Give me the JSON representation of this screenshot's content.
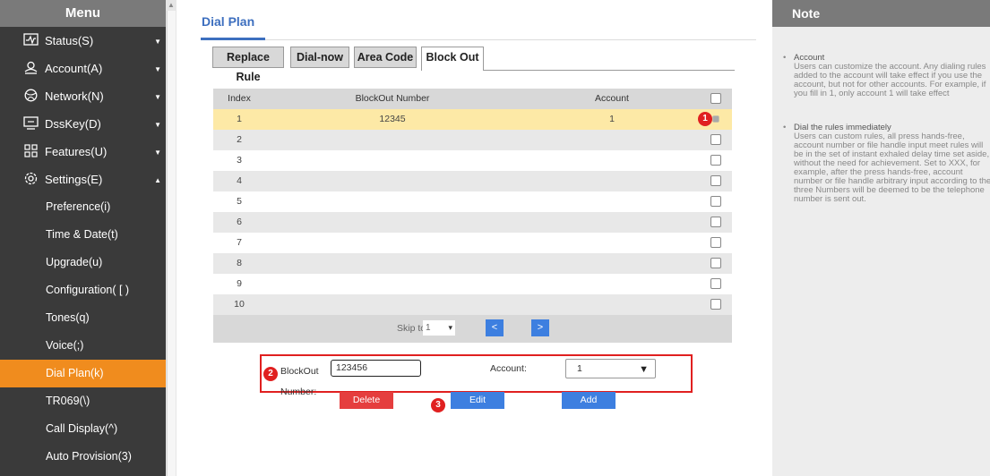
{
  "sidebar": {
    "header": "Menu",
    "items": [
      {
        "label": "Status(S)",
        "icon": "status-icon",
        "caret": "▼"
      },
      {
        "label": "Account(A)",
        "icon": "account-icon",
        "caret": "▼"
      },
      {
        "label": "Network(N)",
        "icon": "network-icon",
        "caret": "▼"
      },
      {
        "label": "DssKey(D)",
        "icon": "dsskey-icon",
        "caret": "▼"
      },
      {
        "label": "Features(U)",
        "icon": "features-icon",
        "caret": "▼"
      },
      {
        "label": "Settings(E)",
        "icon": "settings-icon",
        "caret": "▲"
      }
    ],
    "subitems": [
      "Preference(i)",
      "Time & Date(t)",
      "Upgrade(u)",
      "Configuration( [ )",
      "Tones(q)",
      "Voice(;)",
      "Dial Plan(k)",
      "TR069(\\)",
      "Call Display(^)",
      "Auto Provision(3)"
    ],
    "active_subitem": "Dial Plan(k)",
    "accent_color": "#f08c1e"
  },
  "main": {
    "title": "Dial Plan",
    "tabs": [
      "Replace Rule",
      "Dial-now",
      "Area Code",
      "Block Out"
    ],
    "active_tab": "Block Out",
    "table": {
      "headers": {
        "index": "Index",
        "number": "BlockOut Number",
        "account": "Account"
      },
      "rows": [
        {
          "index": "1",
          "number": "12345",
          "account": "1",
          "selected": true
        },
        {
          "index": "2",
          "number": "",
          "account": ""
        },
        {
          "index": "3",
          "number": "",
          "account": ""
        },
        {
          "index": "4",
          "number": "",
          "account": ""
        },
        {
          "index": "5",
          "number": "",
          "account": ""
        },
        {
          "index": "6",
          "number": "",
          "account": ""
        },
        {
          "index": "7",
          "number": "",
          "account": ""
        },
        {
          "index": "8",
          "number": "",
          "account": ""
        },
        {
          "index": "9",
          "number": "",
          "account": ""
        },
        {
          "index": "10",
          "number": "",
          "account": ""
        }
      ]
    },
    "pager": {
      "skip_label": "Skip to",
      "skip_value": "1",
      "prev": "<",
      "next": ">"
    },
    "form": {
      "blockout_label": "BlockOut Number:",
      "blockout_value": "123456",
      "account_label": "Account:",
      "account_value": "1"
    },
    "buttons": {
      "delete": "Delete",
      "edit": "Edit",
      "add": "Add"
    },
    "markers": {
      "one": "1",
      "two": "2",
      "three": "3"
    },
    "colors": {
      "title_blue": "#3d6fbf",
      "button_blue": "#3d7fe0",
      "delete_red": "#e53e3e",
      "highlight": "#e02020",
      "selected_row": "#fde9a6"
    }
  },
  "note": {
    "header": "Note",
    "items": [
      {
        "title": "Account",
        "text": "Users can customize the account. Any dialing rules added to the account will take effect if you use the account, but not for other accounts. For example, if you fill in 1, only account 1 will take effect"
      },
      {
        "title": "Dial the rules immediately",
        "text": "Users can custom rules, all press hands-free, account number or file handle input meet rules will be in the set of instant exhaled delay time set aside, without the need for achievement. Set to XXX, for example, after the press hands-free, account number or file handle arbitrary input according to the three Numbers will be deemed to be the telephone number is sent out."
      }
    ]
  }
}
